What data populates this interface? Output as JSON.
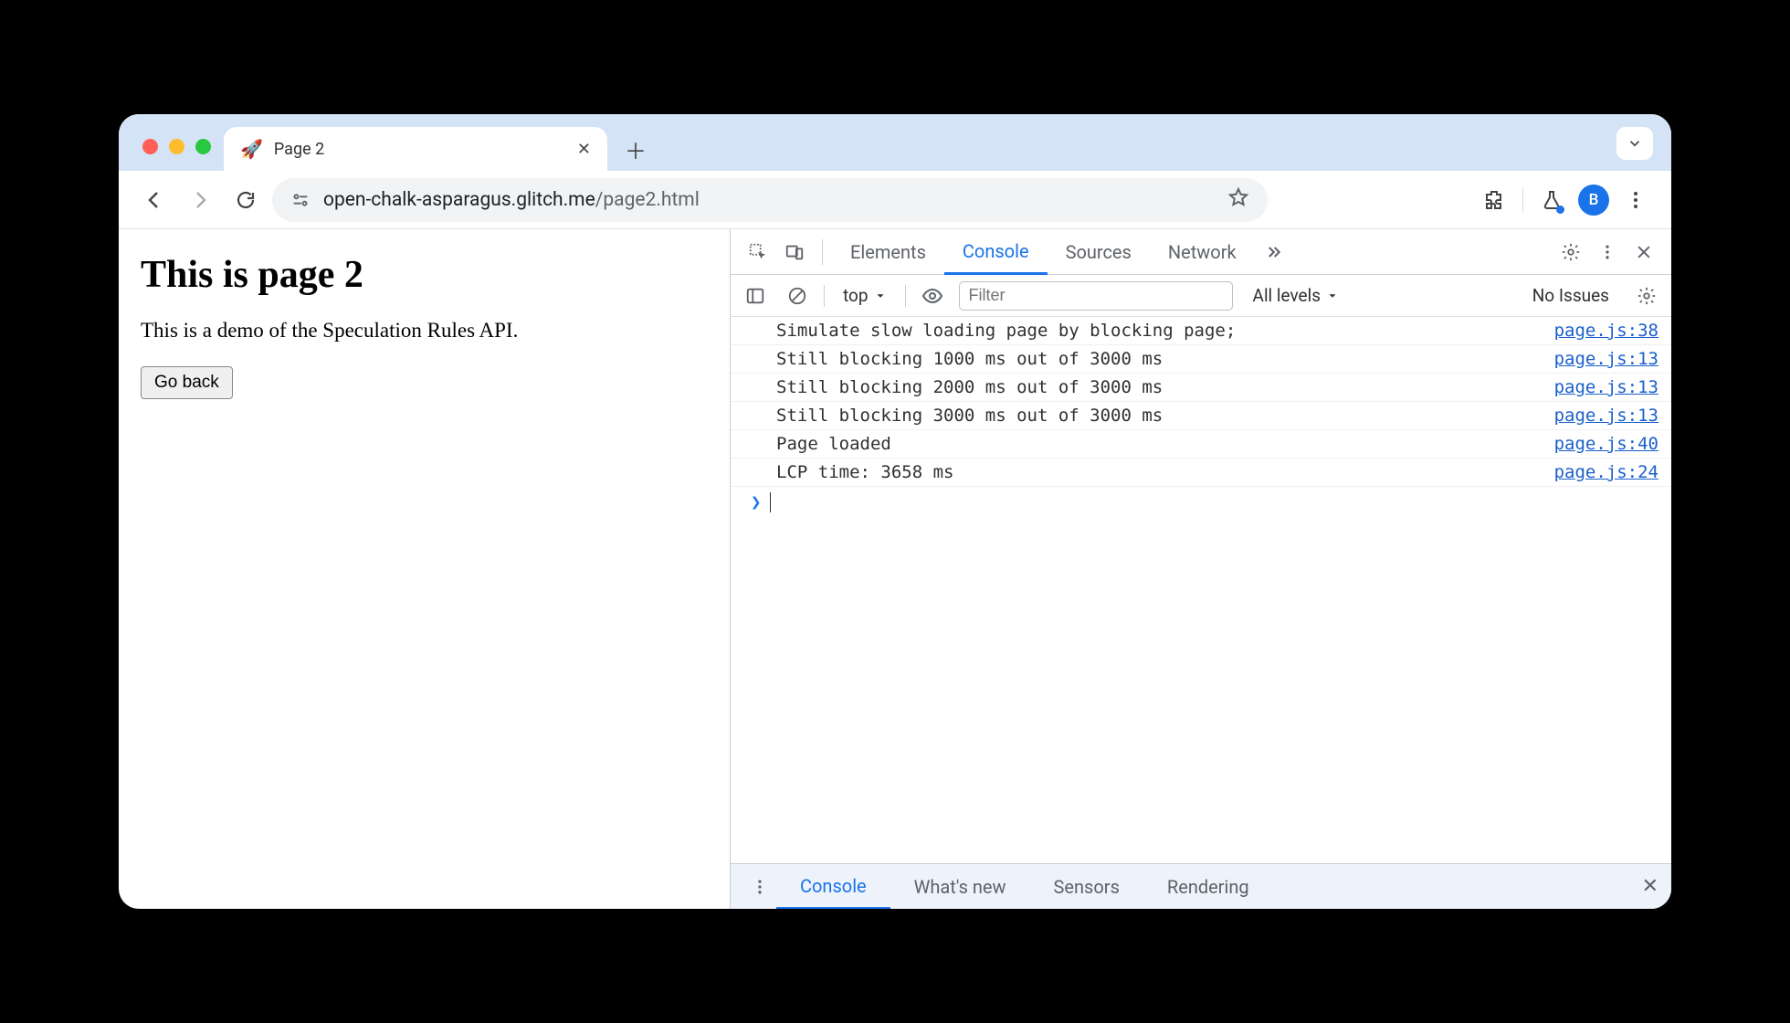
{
  "browser": {
    "tab": {
      "favicon": "🚀",
      "title": "Page 2"
    },
    "url_host": "open-chalk-asparagus.glitch.me",
    "url_path": "/page2.html",
    "avatar_letter": "B"
  },
  "page": {
    "heading": "This is page 2",
    "description": "This is a demo of the Speculation Rules API.",
    "button_label": "Go back"
  },
  "devtools": {
    "tabs": [
      "Elements",
      "Console",
      "Sources",
      "Network"
    ],
    "active_tab": "Console",
    "console_toolbar": {
      "context": "top",
      "filter_placeholder": "Filter",
      "levels": "All levels",
      "issues": "No Issues"
    },
    "logs": [
      {
        "msg": "Simulate slow loading page by blocking page;",
        "src": "page.js:38"
      },
      {
        "msg": "Still blocking 1000 ms out of 3000 ms",
        "src": "page.js:13"
      },
      {
        "msg": "Still blocking 2000 ms out of 3000 ms",
        "src": "page.js:13"
      },
      {
        "msg": "Still blocking 3000 ms out of 3000 ms",
        "src": "page.js:13"
      },
      {
        "msg": "Page loaded",
        "src": "page.js:40"
      },
      {
        "msg": "LCP time: 3658 ms",
        "src": "page.js:24"
      }
    ],
    "drawer": {
      "tabs": [
        "Console",
        "What's new",
        "Sensors",
        "Rendering"
      ],
      "active": "Console"
    }
  }
}
